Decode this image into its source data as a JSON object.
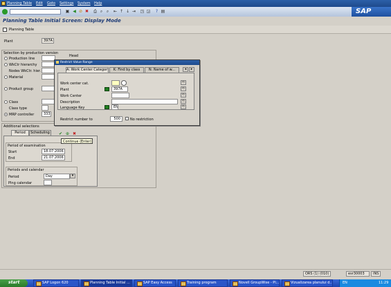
{
  "menu": {
    "items": [
      "Planning Table",
      "Edit",
      "Goto",
      "Settings",
      "System",
      "Help"
    ]
  },
  "logo": "SAP",
  "title": "Planning Table Initial Screen: Display Mode",
  "app_toolbar": {
    "planning_table": "Planning Table"
  },
  "plant": {
    "label": "Plant",
    "value": "397A"
  },
  "sel_version": {
    "title": "Selection by production version",
    "items": [
      {
        "label": "Production line"
      },
      {
        "label": "WkCtr hierarchy"
      },
      {
        "label": "Nodes WkCtr. hier."
      },
      {
        "label": "Material"
      },
      {
        "label": "Product group"
      },
      {
        "label": "Class"
      },
      {
        "label": "Class type"
      },
      {
        "label": "MRP controller",
        "value": "333"
      }
    ],
    "dlg_label": "Head"
  },
  "additional": {
    "title": "Additional selections",
    "tabs": [
      "Period",
      "Scheduling"
    ],
    "period_exam": {
      "title": "Period of examination",
      "start_label": "Start",
      "start_value": "18.07.2006",
      "end_label": "End",
      "end_value": "21.07.2006"
    },
    "periods_cal": {
      "title": "Periods and calendar",
      "period_label": "Period",
      "period_value": "Day",
      "cal_label": "Plng calendar"
    }
  },
  "dialog": {
    "title": "Restrict Value Range",
    "tabs": [
      "A: Work Center Category",
      "K: Find by class",
      "N: Name of w..."
    ],
    "fields": [
      {
        "label": "Work center cat.",
        "value": ""
      },
      {
        "label": "Plant",
        "value": "397A"
      },
      {
        "label": "Work Center",
        "value": ""
      },
      {
        "label": "Description",
        "value": ""
      },
      {
        "label": "Language Key",
        "value": "EN"
      }
    ],
    "restrict_label": "Restrict number to",
    "restrict_value": "500",
    "no_restriction": "No restriction",
    "tooltip": "Continue   (Enter)"
  },
  "status": {
    "session": "ORS (1) (010)",
    "server": "esr30003",
    "mode": "INS"
  },
  "taskbar": {
    "start": "start",
    "items": [
      "SAP Logon 620",
      "Planning Table Initial ...",
      "SAP Easy Access",
      "Training program",
      "Novell GroupWise - Pl...",
      "Vizualizarea planului d..."
    ],
    "lang": "EN",
    "clock": "11:29"
  }
}
